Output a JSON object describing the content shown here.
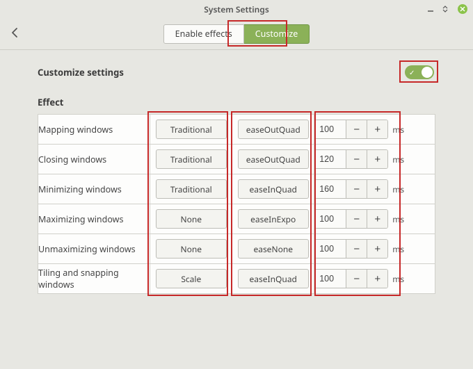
{
  "window": {
    "title": "System Settings"
  },
  "tabs": {
    "left": "Enable effects",
    "right": "Customize"
  },
  "customize": {
    "heading": "Customize settings",
    "enabled": true
  },
  "section": {
    "effect_label": "Effect"
  },
  "unit_label": "ms",
  "rows": [
    {
      "name": "Mapping windows",
      "style": "Traditional",
      "easing": "easeOutQuad",
      "ms": "100"
    },
    {
      "name": "Closing windows",
      "style": "Traditional",
      "easing": "easeOutQuad",
      "ms": "120"
    },
    {
      "name": "Minimizing windows",
      "style": "Traditional",
      "easing": "easeInQuad",
      "ms": "160"
    },
    {
      "name": "Maximizing windows",
      "style": "None",
      "easing": "easeInExpo",
      "ms": "100"
    },
    {
      "name": "Unmaximizing windows",
      "style": "None",
      "easing": "easeNone",
      "ms": "100"
    },
    {
      "name": "Tiling and snapping windows",
      "style": "Scale",
      "easing": "easeInQuad",
      "ms": "100"
    }
  ],
  "highlights": {
    "tab_customize": true,
    "toggle": true,
    "style_column": true,
    "easing_column": true,
    "spin_column": true
  }
}
